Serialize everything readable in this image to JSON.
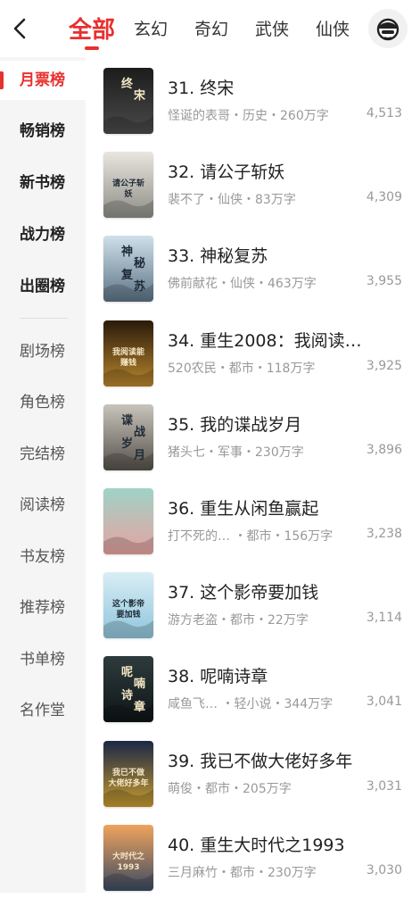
{
  "header": {
    "tabs": [
      {
        "label": "全部",
        "active": true
      },
      {
        "label": "玄幻"
      },
      {
        "label": "奇幻"
      },
      {
        "label": "武侠"
      },
      {
        "label": "仙侠"
      }
    ],
    "accent_color": "#e8302f"
  },
  "sidebar": {
    "items": [
      {
        "label": "月票榜"
      },
      {
        "label": "畅销榜"
      },
      {
        "label": "新书榜"
      },
      {
        "label": "战力榜"
      },
      {
        "label": "出圈榜"
      },
      {
        "label": "剧场榜"
      },
      {
        "label": "角色榜"
      },
      {
        "label": "完结榜"
      },
      {
        "label": "阅读榜"
      },
      {
        "label": "书友榜"
      },
      {
        "label": "推荐榜"
      },
      {
        "label": "书单榜"
      },
      {
        "label": "名作堂"
      }
    ],
    "selected": "月票榜"
  },
  "books": [
    {
      "title": "31. 终宋",
      "meta": "怪诞的表哥・历史・260万字",
      "count": "4,513",
      "cover_text": "终宋",
      "cover_colors": [
        "#1c1c1c",
        "#4a4a4a"
      ]
    },
    {
      "title": "32. 请公子斩妖",
      "meta": "裴不了・仙侠・83万字",
      "count": "4,309",
      "cover_text": "请公子斩妖",
      "cover_colors": [
        "#e9e6df",
        "#8d8d86"
      ]
    },
    {
      "title": "33. 神秘复苏",
      "meta": "佛前献花・仙侠・463万字",
      "count": "3,955",
      "cover_text": "神秘复苏",
      "cover_colors": [
        "#cfe0ea",
        "#5c7384"
      ]
    },
    {
      "title": "34. 重生2008：我阅读…",
      "meta": "520农民・都市・118万字",
      "count": "3,925",
      "cover_text": "我阅读能赚钱",
      "cover_colors": [
        "#2a1a0a",
        "#b8862d"
      ]
    },
    {
      "title": "35. 我的谍战岁月",
      "meta": "猪头七・军事・230万字",
      "count": "3,896",
      "cover_text": "谍战岁月",
      "cover_colors": [
        "#c9c4bb",
        "#55504a"
      ]
    },
    {
      "title": "36. 重生从闲鱼赢起",
      "meta": "打不死的… ・都市・156万字",
      "count": "3,238",
      "cover_text": "",
      "cover_colors": [
        "#9fd3c7",
        "#e7a2a0"
      ]
    },
    {
      "title": "37. 这个影帝要加钱",
      "meta": "游方老盗・都市・22万字",
      "count": "3,114",
      "cover_text": "这个影帝要加钱",
      "cover_colors": [
        "#d9eef6",
        "#8fc4da"
      ]
    },
    {
      "title": "38. 呢喃诗章",
      "meta": "咸鱼飞… ・轻小说・344万字",
      "count": "3,041",
      "cover_text": "呢喃诗章",
      "cover_colors": [
        "#2e3b3d",
        "#0e1516"
      ]
    },
    {
      "title": "39. 我已不做大佬好多年",
      "meta": "萌俊・都市・205万字",
      "count": "3,031",
      "cover_text": "我已不做大佬好多年",
      "cover_colors": [
        "#1b2746",
        "#c79b2f"
      ]
    },
    {
      "title": "40. 重生大时代之1993",
      "meta": "三月麻竹・都市・230万字",
      "count": "3,030",
      "cover_text": "大时代之1993",
      "cover_colors": [
        "#f0a35c",
        "#3a4a63"
      ]
    }
  ]
}
